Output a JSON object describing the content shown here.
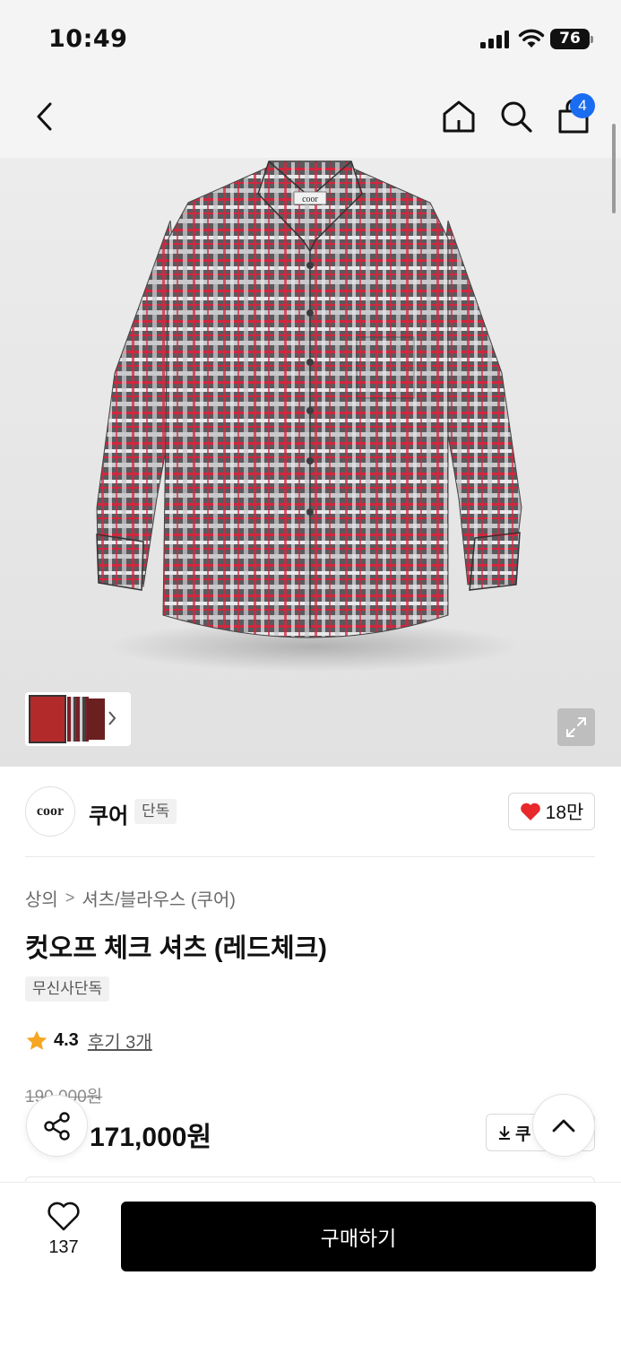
{
  "status_bar": {
    "time": "10:49",
    "battery": "76"
  },
  "nav": {
    "cart_count": "4"
  },
  "gallery": {
    "thumbnail_count": 3,
    "shirt_logo": "coor"
  },
  "brand": {
    "logo_text": "coor",
    "name": "쿠어",
    "badge": "단독",
    "like_count": "18만"
  },
  "breadcrumb": {
    "category": "상의",
    "separator": ">",
    "subcategory": "셔츠/블라우스 (쿠어)"
  },
  "product": {
    "title": "컷오프 체크 셔츠 (레드체크)",
    "tag": "무신사단독",
    "rating": "4.3",
    "review_link": "후기 3개",
    "original_price": "190,000원",
    "sale_price": "171,000원",
    "coupon_label": "쿠"
  },
  "bottom_bar": {
    "wish_count": "137",
    "buy_label": "구매하기"
  },
  "colors": {
    "accent_blue": "#1a6cf0",
    "heart_red": "#e8282b",
    "star": "#f5a623",
    "primary_button": "#000000"
  },
  "icons": [
    "back-icon",
    "home-icon",
    "search-icon",
    "cart-icon",
    "expand-icon",
    "heart-icon",
    "star-icon",
    "download-icon",
    "share-icon",
    "chevron-up-icon",
    "chevron-right-icon"
  ]
}
